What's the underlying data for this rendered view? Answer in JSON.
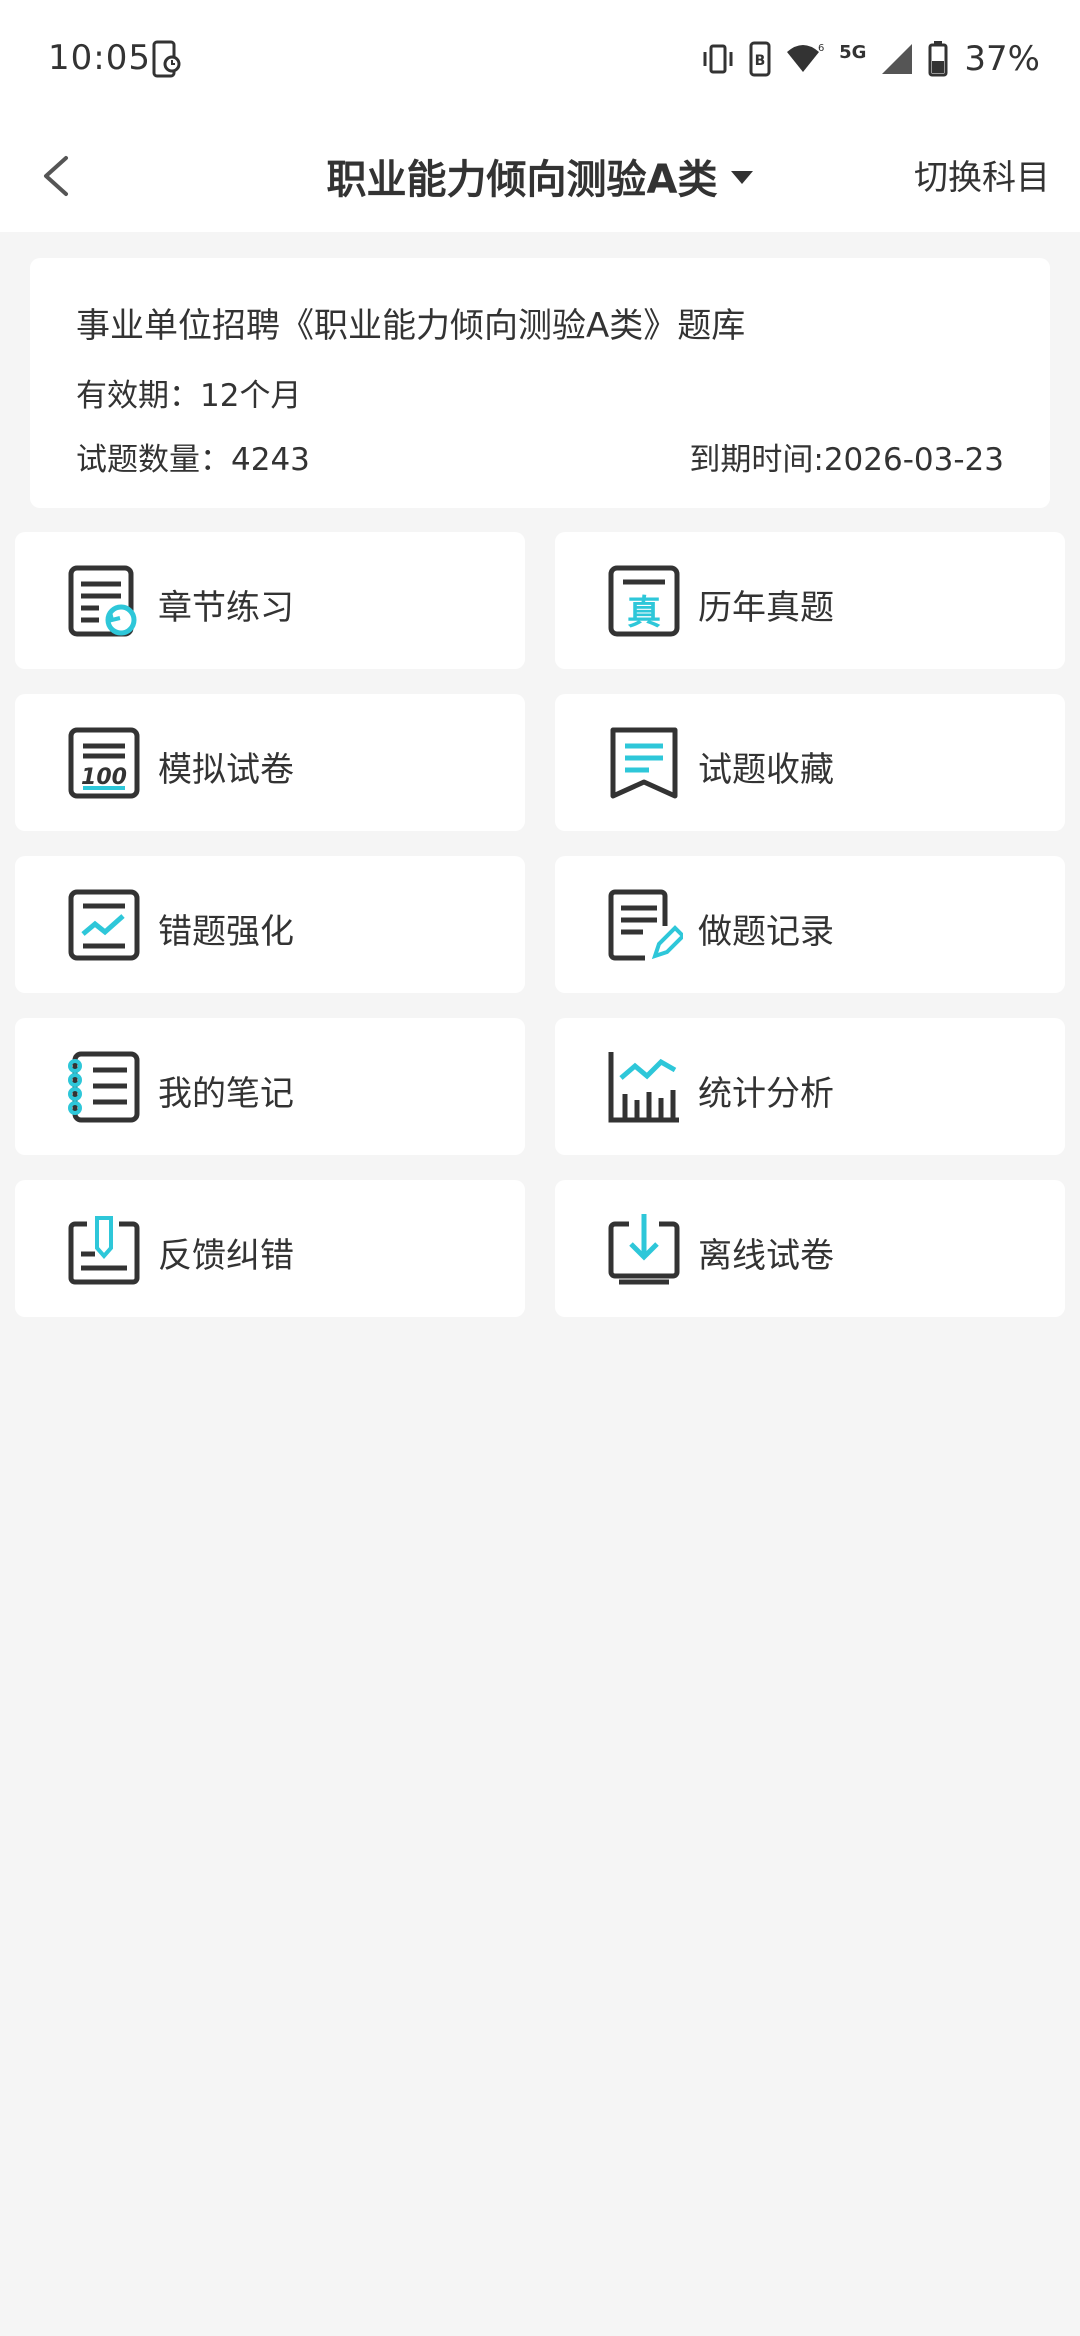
{
  "status_bar": {
    "time": "10:05",
    "network": "5G",
    "battery_percent": "37%"
  },
  "header": {
    "title": "职业能力倾向测验A类",
    "switch_subject_label": "切换科目"
  },
  "info_card": {
    "title": "事业单位招聘《职业能力倾向测验A类》题库",
    "validity": "有效期：12个月",
    "question_count": "试题数量：4243",
    "expiry": "到期时间:2026-03-23"
  },
  "menu": {
    "items": [
      {
        "label": "章节练习",
        "icon": "chapter-practice-icon"
      },
      {
        "label": "历年真题",
        "icon": "past-papers-icon"
      },
      {
        "label": "模拟试卷",
        "icon": "mock-exam-icon"
      },
      {
        "label": "试题收藏",
        "icon": "favorites-icon"
      },
      {
        "label": "错题强化",
        "icon": "wrong-questions-icon"
      },
      {
        "label": "做题记录",
        "icon": "answer-history-icon"
      },
      {
        "label": "我的笔记",
        "icon": "notes-icon"
      },
      {
        "label": "统计分析",
        "icon": "statistics-icon"
      },
      {
        "label": "反馈纠错",
        "icon": "feedback-icon"
      },
      {
        "label": "离线试卷",
        "icon": "offline-download-icon"
      }
    ]
  },
  "colors": {
    "accent": "#2ec7d9",
    "icon_dark": "#333333",
    "background": "#f5f5f5",
    "card": "#ffffff"
  }
}
